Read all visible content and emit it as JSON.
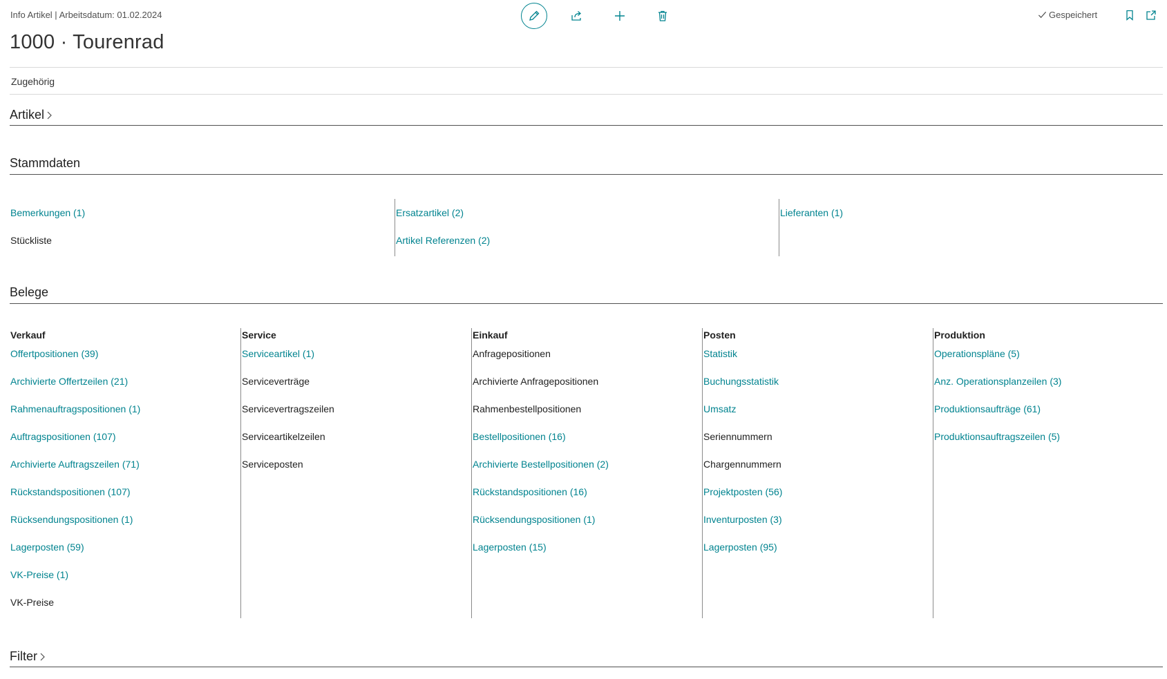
{
  "header": {
    "caption": "Info Artikel | Arbeitsdatum: 01.02.2024",
    "title": "1000 · Tourenrad",
    "saved_label": "Gespeichert",
    "icons": [
      "edit-icon",
      "share-icon",
      "plus-icon",
      "delete-icon",
      "bookmark-icon",
      "open-new-window-icon"
    ]
  },
  "related": {
    "label": "Zugehörig"
  },
  "sections": {
    "artikel": "Artikel",
    "stammdaten": "Stammdaten",
    "belege": "Belege",
    "filter": "Filter"
  },
  "stammdaten": {
    "columns": [
      {
        "items": [
          {
            "label": "Bemerkungen (1)",
            "link": true
          },
          {
            "label": "Stückliste",
            "link": false
          }
        ]
      },
      {
        "items": [
          {
            "label": "Ersatzartikel (2)",
            "link": true
          },
          {
            "label": "Artikel Referenzen (2)",
            "link": true
          }
        ]
      },
      {
        "items": [
          {
            "label": "Lieferanten (1)",
            "link": true
          }
        ]
      }
    ]
  },
  "belege": {
    "columns": [
      {
        "heading": "Verkauf",
        "items": [
          {
            "label": "Offertpositionen (39)",
            "link": true
          },
          {
            "label": "Archivierte Offertzeilen (21)",
            "link": true
          },
          {
            "label": "Rahmenauftragspositionen (1)",
            "link": true
          },
          {
            "label": "Auftragspositionen (107)",
            "link": true
          },
          {
            "label": "Archivierte Auftragszeilen (71)",
            "link": true
          },
          {
            "label": "Rückstandspositionen (107)",
            "link": true
          },
          {
            "label": "Rücksendungspositionen (1)",
            "link": true
          },
          {
            "label": "Lagerposten (59)",
            "link": true
          },
          {
            "label": "VK-Preise (1)",
            "link": true
          },
          {
            "label": "VK-Preise",
            "link": false
          }
        ]
      },
      {
        "heading": "Service",
        "items": [
          {
            "label": "Serviceartikel (1)",
            "link": true
          },
          {
            "label": "Serviceverträge",
            "link": false
          },
          {
            "label": "Servicevertragszeilen",
            "link": false
          },
          {
            "label": "Serviceartikelzeilen",
            "link": false
          },
          {
            "label": "Serviceposten",
            "link": false
          }
        ]
      },
      {
        "heading": "Einkauf",
        "items": [
          {
            "label": "Anfragepositionen",
            "link": false
          },
          {
            "label": "Archivierte Anfragepositionen",
            "link": false
          },
          {
            "label": "Rahmenbestellpositionen",
            "link": false
          },
          {
            "label": "Bestellpositionen (16)",
            "link": true
          },
          {
            "label": "Archivierte Bestellpositionen (2)",
            "link": true
          },
          {
            "label": "Rückstandspositionen (16)",
            "link": true
          },
          {
            "label": "Rücksendungspositionen (1)",
            "link": true
          },
          {
            "label": "Lagerposten (15)",
            "link": true
          }
        ]
      },
      {
        "heading": "Posten",
        "items": [
          {
            "label": "Statistik",
            "link": true
          },
          {
            "label": "Buchungsstatistik",
            "link": true
          },
          {
            "label": "Umsatz",
            "link": true
          },
          {
            "label": "Seriennummern",
            "link": false
          },
          {
            "label": "Chargennummern",
            "link": false
          },
          {
            "label": "Projektposten (56)",
            "link": true
          },
          {
            "label": "Inventurposten (3)",
            "link": true
          },
          {
            "label": "Lagerposten (95)",
            "link": true
          }
        ]
      },
      {
        "heading": "Produktion",
        "items": [
          {
            "label": "Operationspläne (5)",
            "link": true
          },
          {
            "label": "Anz. Operationsplanzeilen (3)",
            "link": true
          },
          {
            "label": "Produktionsaufträge (61)",
            "link": true
          },
          {
            "label": "Produktionsauftragszeilen (5)",
            "link": true
          }
        ]
      }
    ]
  },
  "colors": {
    "accent": "#00838f",
    "text": "#212121",
    "divider": "#505050"
  }
}
